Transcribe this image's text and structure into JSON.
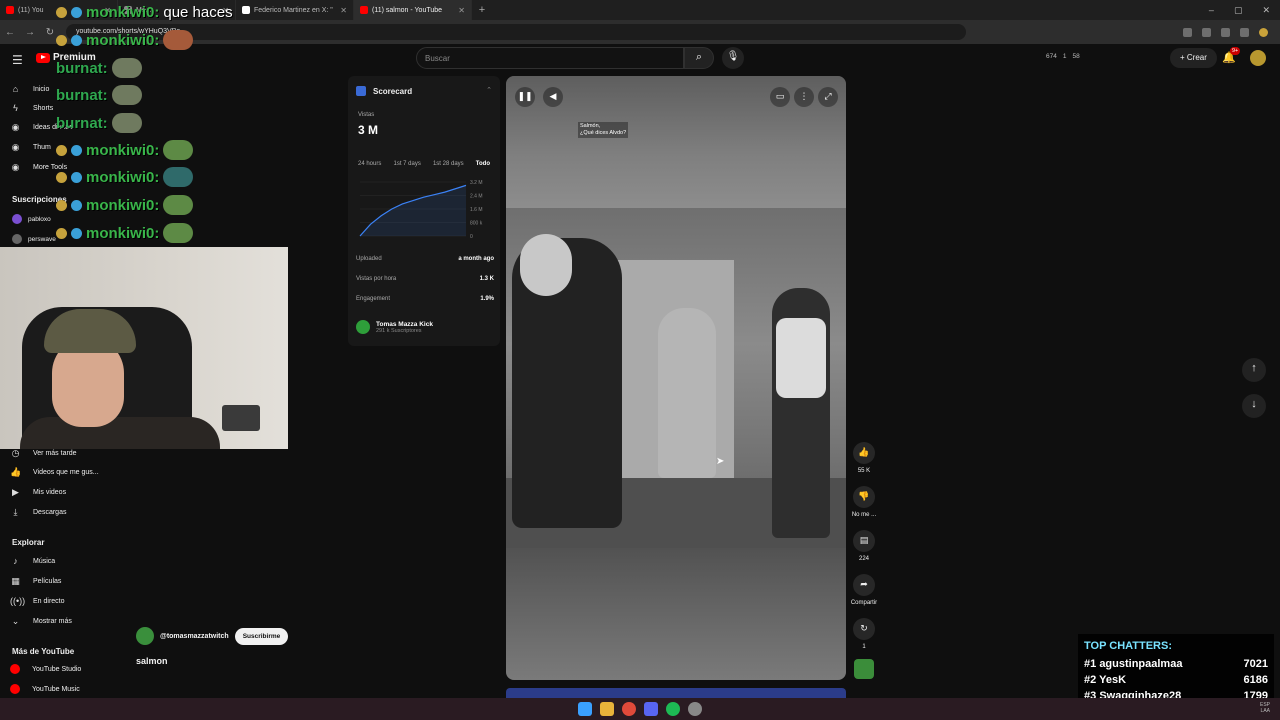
{
  "browser": {
    "tabs": [
      {
        "label": "(11) You",
        "color": "#ff0000",
        "active": false
      },
      {
        "label": "Mo...",
        "color": "#888888",
        "active": false
      },
      {
        "label": "Federico Martinez en X: \"",
        "color": "#ffffff",
        "active": false
      },
      {
        "label": "(11) salmon - YouTube",
        "color": "#ff0000",
        "active": true
      }
    ],
    "url": "youtube.com/shorts/wYHuQ3VBe",
    "window_controls": [
      "–",
      "▢",
      "✕"
    ]
  },
  "youtube": {
    "logo_text": "Premium",
    "search_placeholder": "Buscar",
    "header_stats": [
      "674",
      "1",
      "58"
    ],
    "create_label": "Crear",
    "notifications": "9+"
  },
  "sidebar": {
    "top_items": [
      {
        "label": "Inicio",
        "icon": "home-icon"
      },
      {
        "label": "Shorts",
        "icon": "shorts-icon"
      }
    ],
    "tool_items": [
      "Ideas diarias",
      "Thum",
      "More Tools"
    ],
    "subscriptions_title": "Suscripciones",
    "subscriptions": [
      {
        "label": "pabloxo",
        "color": "#7a4fd1"
      },
      {
        "label": "perswave",
        "color": "#666666"
      }
    ],
    "library_items": [
      {
        "label": "Ver más tarde",
        "icon": "clock-icon"
      },
      {
        "label": "Videos que me gus...",
        "icon": "like-icon"
      },
      {
        "label": "Mis videos",
        "icon": "video-icon"
      },
      {
        "label": "Descargas",
        "icon": "download-icon"
      }
    ],
    "explore_title": "Explorar",
    "explore_items": [
      {
        "label": "Música",
        "icon": "music-icon"
      },
      {
        "label": "Películas",
        "icon": "film-icon"
      },
      {
        "label": "En directo",
        "icon": "live-icon"
      },
      {
        "label": "Mostrar más",
        "icon": "chevron-down-icon"
      }
    ],
    "more_title": "Más de YouTube",
    "more_items": [
      "YouTube Studio",
      "YouTube Music"
    ]
  },
  "chat_overlay": {
    "lines": [
      {
        "name": "monkiwi0:",
        "msg": "que haces"
      },
      {
        "name": "monkiwi0:",
        "msg": ""
      },
      {
        "name": "burnat:",
        "msg": ""
      },
      {
        "name": "burnat:",
        "msg": ""
      },
      {
        "name": "burnat:",
        "msg": ""
      },
      {
        "name": "monkiwi0:",
        "msg": ""
      },
      {
        "name": "monkiwi0:",
        "msg": ""
      },
      {
        "name": "monkiwi0:",
        "msg": ""
      },
      {
        "name": "monkiwi0:",
        "msg": ""
      }
    ]
  },
  "scorecard": {
    "title": "Scorecard",
    "views_label": "Vistas",
    "views_value": "3 M",
    "ranges": [
      "24 hours",
      "1st 7 days",
      "1st 28 days",
      "Todo"
    ],
    "active_range": "Todo",
    "rows": [
      {
        "label": "Uploaded",
        "value": "a month ago"
      },
      {
        "label": "Vistas por hora",
        "value": "1.3 K"
      },
      {
        "label": "Engagement",
        "value": "1.9%"
      }
    ],
    "channel_name": "Tomas Mazza Kick",
    "channel_subs": "291 k Suscriptores"
  },
  "chart_data": {
    "type": "line",
    "x": [
      0,
      1,
      2,
      3,
      4,
      5,
      6,
      7,
      8,
      9,
      10
    ],
    "series": [
      {
        "values": [
          0,
          0.7,
          1.2,
          1.6,
          1.9,
          2.1,
          2.3,
          2.45,
          2.6,
          2.8,
          3.0
        ]
      }
    ],
    "ylim": [
      0,
      3.2
    ],
    "ytick_labels": [
      "3.2 M",
      "2.4 M",
      "1.6 M",
      "800 k",
      "0"
    ],
    "color": "#3b82f6"
  },
  "video": {
    "caption_line1": "Salmón,",
    "caption_line2": "¿Qué dices Alvdo?",
    "actions": [
      {
        "icon": "like-icon",
        "label": "55 K"
      },
      {
        "icon": "dislike-icon",
        "label": "No me ..."
      },
      {
        "icon": "comment-icon",
        "label": "224"
      },
      {
        "icon": "share-icon",
        "label": "Compartir"
      },
      {
        "icon": "remix-icon",
        "label": "1"
      }
    ],
    "channel": "@tomasmazzatwitch",
    "subscribe_label": "Suscribirme",
    "title": "salmon"
  },
  "top_chatters": {
    "title": "TOP CHATTERS:",
    "rows": [
      {
        "rank": "#1",
        "name": "agustinpaalmaa",
        "count": "7021"
      },
      {
        "rank": "#2",
        "name": "YesK",
        "count": "6186"
      },
      {
        "rank": "#3",
        "name": "Swagginhaze28",
        "count": "1799"
      }
    ]
  },
  "taskbar": {
    "tray_lines": [
      "ESP",
      "LAA"
    ],
    "icons": [
      {
        "name": "windows-icon",
        "color": "#3aa0ff"
      },
      {
        "name": "folder-icon",
        "color": "#e8b33a"
      },
      {
        "name": "chrome-icon",
        "color": "#e04a3a"
      },
      {
        "name": "discord-icon",
        "color": "#5865f2"
      },
      {
        "name": "spotify-icon",
        "color": "#1db954"
      },
      {
        "name": "app-icon",
        "color": "#888888"
      }
    ]
  }
}
